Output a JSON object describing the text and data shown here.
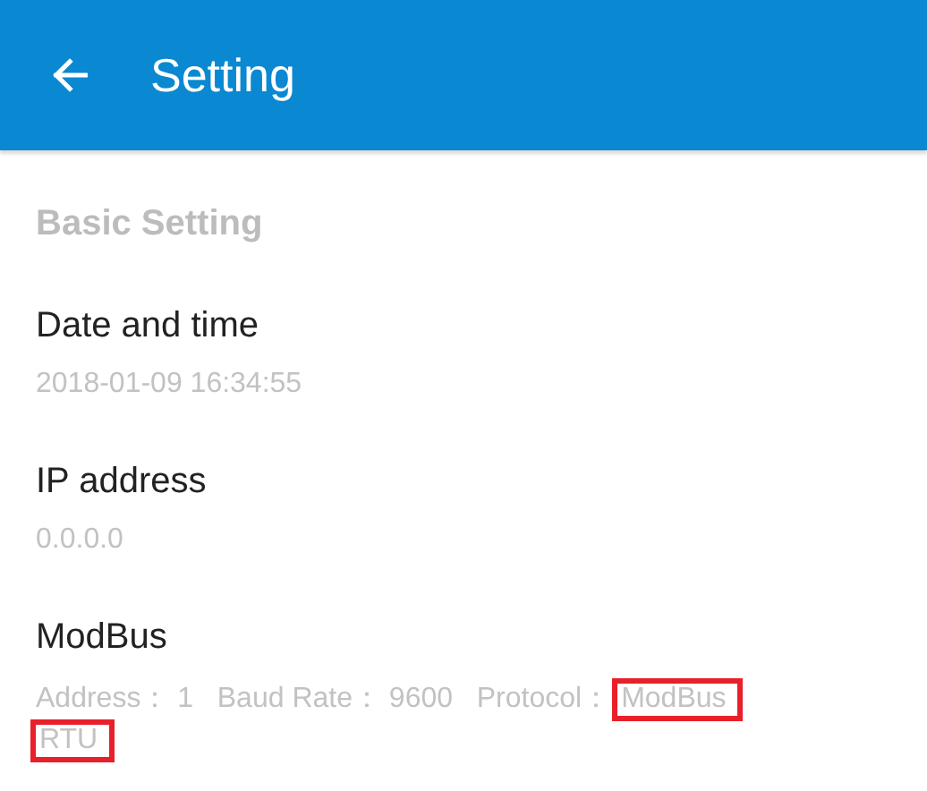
{
  "header": {
    "title": "Setting"
  },
  "section": "Basic Setting",
  "items": [
    {
      "title": "Date and time",
      "value": "2018-01-09 16:34:55"
    },
    {
      "title": "IP address",
      "value": "0.0.0.0"
    },
    {
      "title": "ModBus",
      "value": "Address： 1   Baud Rate： 9600   Protocol：",
      "highlighted": [
        "ModBus",
        "RTU"
      ]
    }
  ]
}
